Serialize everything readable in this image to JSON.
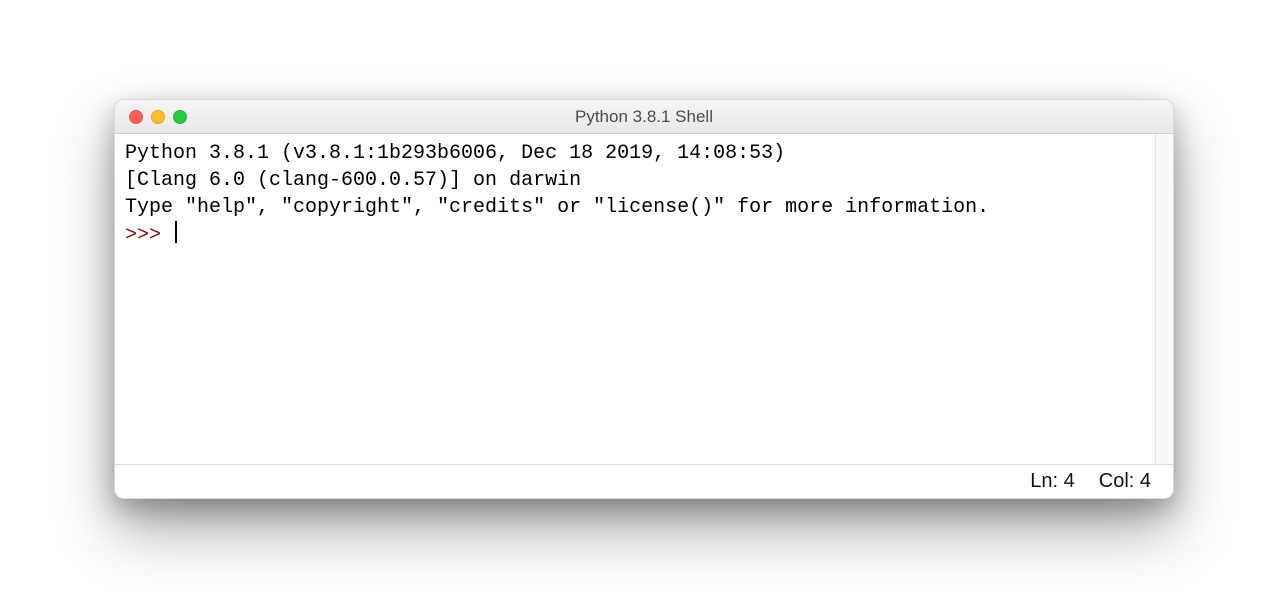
{
  "window": {
    "title": "Python 3.8.1 Shell"
  },
  "shell": {
    "banner_line1": "Python 3.8.1 (v3.8.1:1b293b6006, Dec 18 2019, 14:08:53) ",
    "banner_line2": "[Clang 6.0 (clang-600.0.57)] on darwin",
    "banner_line3": "Type \"help\", \"copyright\", \"credits\" or \"license()\" for more information.",
    "prompt": ">>> "
  },
  "status": {
    "line_label": "Ln: 4",
    "col_label": "Col: 4"
  }
}
